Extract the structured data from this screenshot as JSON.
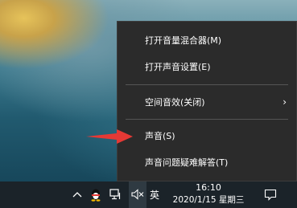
{
  "context_menu": {
    "items": [
      {
        "label": "打开音量混合器(M)"
      },
      {
        "label": "打开声音设置(E)"
      },
      {
        "label": "空间音效(关闭)",
        "has_submenu": true
      },
      {
        "label": "声音(S)"
      },
      {
        "label": "声音问题疑难解答(T)"
      }
    ]
  },
  "taskbar": {
    "ime_label": "英",
    "time": "16:10",
    "date": "2020/1/15 星期三"
  },
  "icons": {
    "chevron_up": "chevron-up-icon",
    "qq": "qq-icon",
    "network": "network-icon",
    "volume": "volume-muted-icon",
    "notification": "notification-icon",
    "submenu": "chevron-right-icon",
    "annotation": "red-arrow-annotation"
  },
  "colors": {
    "menu_bg": "#2b2b2b",
    "taskbar_bg": "#1b2329",
    "arrow": "#e53935"
  }
}
